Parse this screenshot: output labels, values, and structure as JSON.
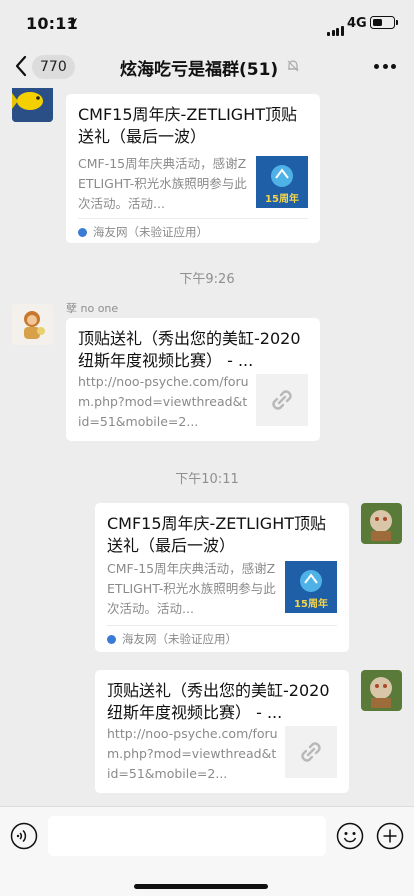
{
  "status": {
    "time": "10:11",
    "network": "4G"
  },
  "nav": {
    "unread": "770",
    "title": "炫海吃亏是福群(51)"
  },
  "messages": [
    {
      "title": "CMF15周年庆-ZETLIGHT顶贴送礼（最后一波）",
      "desc": "CMF-15周年庆典活动，感谢ZETLIGHT-积光水族照明参与此次活动。活动...",
      "source": "海友网（未验证应用）"
    },
    {
      "time": "下午9:26",
      "sender": "孽 no one",
      "title": "顶贴送礼（秀出您的美缸-2020纽斯年度视频比赛） - ...",
      "desc": "http://noo-psyche.com/forum.php?mod=viewthread&tid=51&mobile=2..."
    },
    {
      "time": "下午10:11",
      "title": "CMF15周年庆-ZETLIGHT顶贴送礼（最后一波）",
      "desc": "CMF-15周年庆典活动，感谢ZETLIGHT-积光水族照明参与此次活动。活动...",
      "source": "海友网（未验证应用）"
    },
    {
      "title": "顶贴送礼（秀出您的美缸-2020纽斯年度视频比赛） - ...",
      "desc": "http://noo-psyche.com/forum.php?mod=viewthread&tid=51&mobile=2..."
    }
  ],
  "thumb_text": "15周年",
  "icons": {
    "back": "chevron-left-icon",
    "mute": "mute-bell-icon",
    "more": "more-dots-icon",
    "link": "link-icon",
    "voice": "voice-icon",
    "emoji": "emoji-icon",
    "plus": "plus-icon"
  },
  "colors": {
    "background": "#ededed",
    "card": "#ffffff",
    "meta": "#8f8f8f",
    "thumb_blue": "#1e5fa8"
  }
}
